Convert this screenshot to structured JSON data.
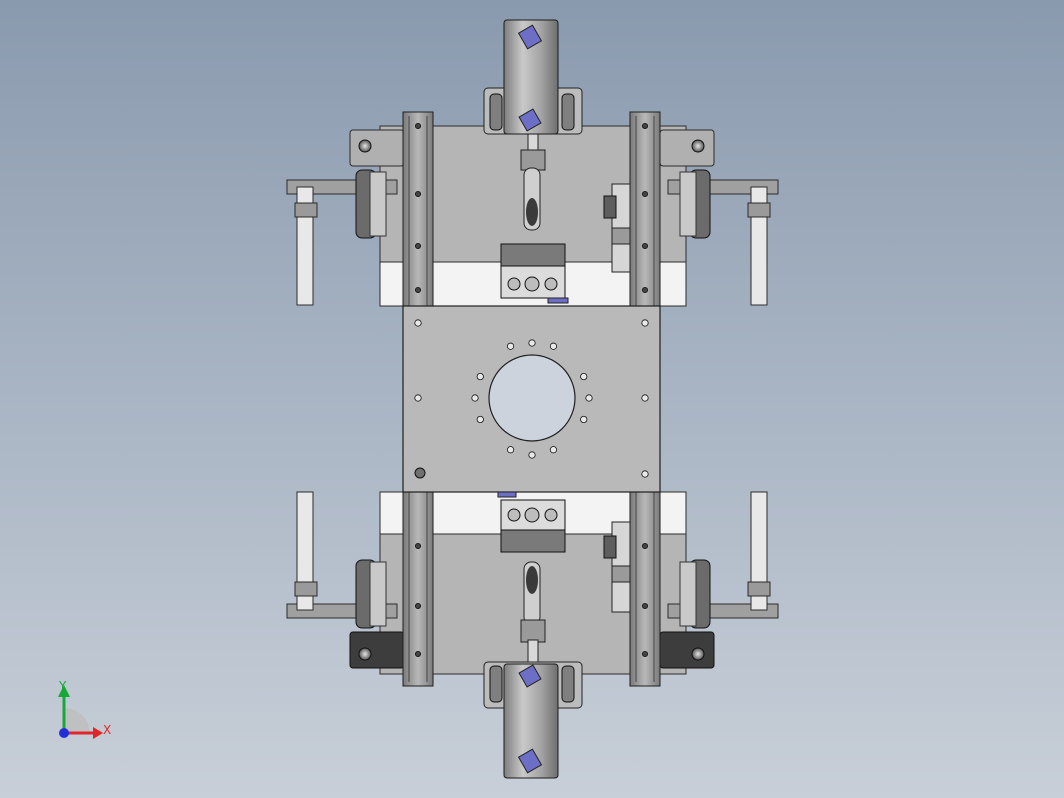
{
  "axis_triad": {
    "x_label": "X",
    "y_label": "Y",
    "x_color": "#e0262b",
    "y_color": "#18a83a",
    "z_color": "#2330d8"
  },
  "colors": {
    "background_top": "#8a9aae",
    "background_bottom": "#c8cfd8",
    "plate": "#b3b3b3",
    "plate_dark": "#8e8e8e",
    "rail": "#9c9c9c",
    "edge": "#2b2b2b",
    "white_part": "#f4f4f4",
    "cylinder": "#a7a7a7",
    "fitting_blue": "#6d6fc6"
  }
}
